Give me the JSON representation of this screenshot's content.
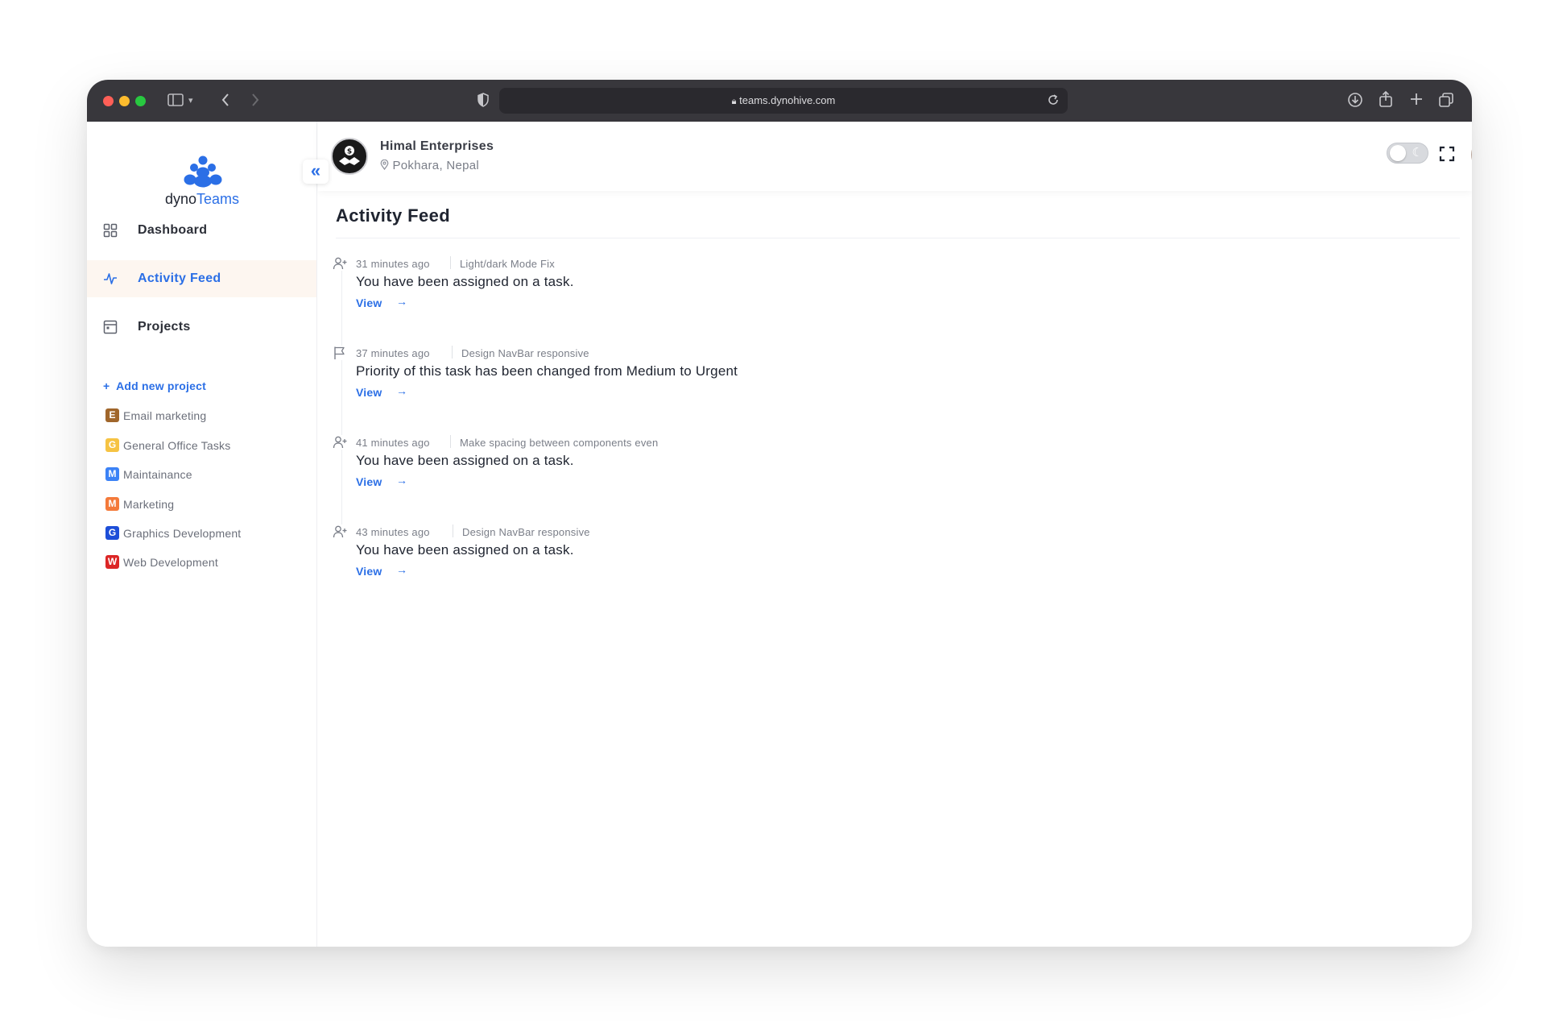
{
  "browser": {
    "url": "teams.dynohive.com",
    "traffic_lights": [
      "#ff5f57",
      "#febc2e",
      "#28c840"
    ]
  },
  "sidebar": {
    "logo": {
      "part1": "dyno",
      "part2": "Teams"
    },
    "nav": [
      {
        "label": "Dashboard",
        "icon": "grid-icon",
        "active": false
      },
      {
        "label": "Activity Feed",
        "icon": "activity-pulse-icon",
        "active": true
      },
      {
        "label": "Projects",
        "icon": "projects-icon",
        "active": false
      }
    ],
    "add_project_label": "Add new project",
    "projects": [
      {
        "letter": "E",
        "name": "Email marketing",
        "color": "#a0662b"
      },
      {
        "letter": "G",
        "name": "General Office Tasks",
        "color": "#f6c343"
      },
      {
        "letter": "M",
        "name": "Maintainance",
        "color": "#3b82f6"
      },
      {
        "letter": "M",
        "name": "Marketing",
        "color": "#f47a3a"
      },
      {
        "letter": "G",
        "name": "Graphics Development",
        "color": "#1d4ed8"
      },
      {
        "letter": "W",
        "name": "Web Development",
        "color": "#dc2626"
      }
    ]
  },
  "topbar": {
    "company_name": "Himal Enterprises",
    "company_location": "Pokhara, Nepal"
  },
  "main": {
    "title": "Activity Feed",
    "view_label": "View",
    "activities": [
      {
        "icon": "user-add-icon",
        "time": "31 minutes ago",
        "task": "Light/dark Mode Fix",
        "message": "You have been assigned on a task."
      },
      {
        "icon": "flag-icon",
        "time": "37 minutes ago",
        "task": "Design NavBar responsive",
        "message": "Priority of this task has been changed from Medium to Urgent"
      },
      {
        "icon": "user-add-icon",
        "time": "41 minutes ago",
        "task": "Make spacing between components even",
        "message": "You have been assigned on a task."
      },
      {
        "icon": "user-add-icon",
        "time": "43 minutes ago",
        "task": "Design NavBar responsive",
        "message": "You have been assigned on a task."
      }
    ]
  },
  "colors": {
    "accent": "#2b6fe6",
    "active_nav_bg": "#fdf6f0",
    "chrome_bg": "#38373c"
  }
}
